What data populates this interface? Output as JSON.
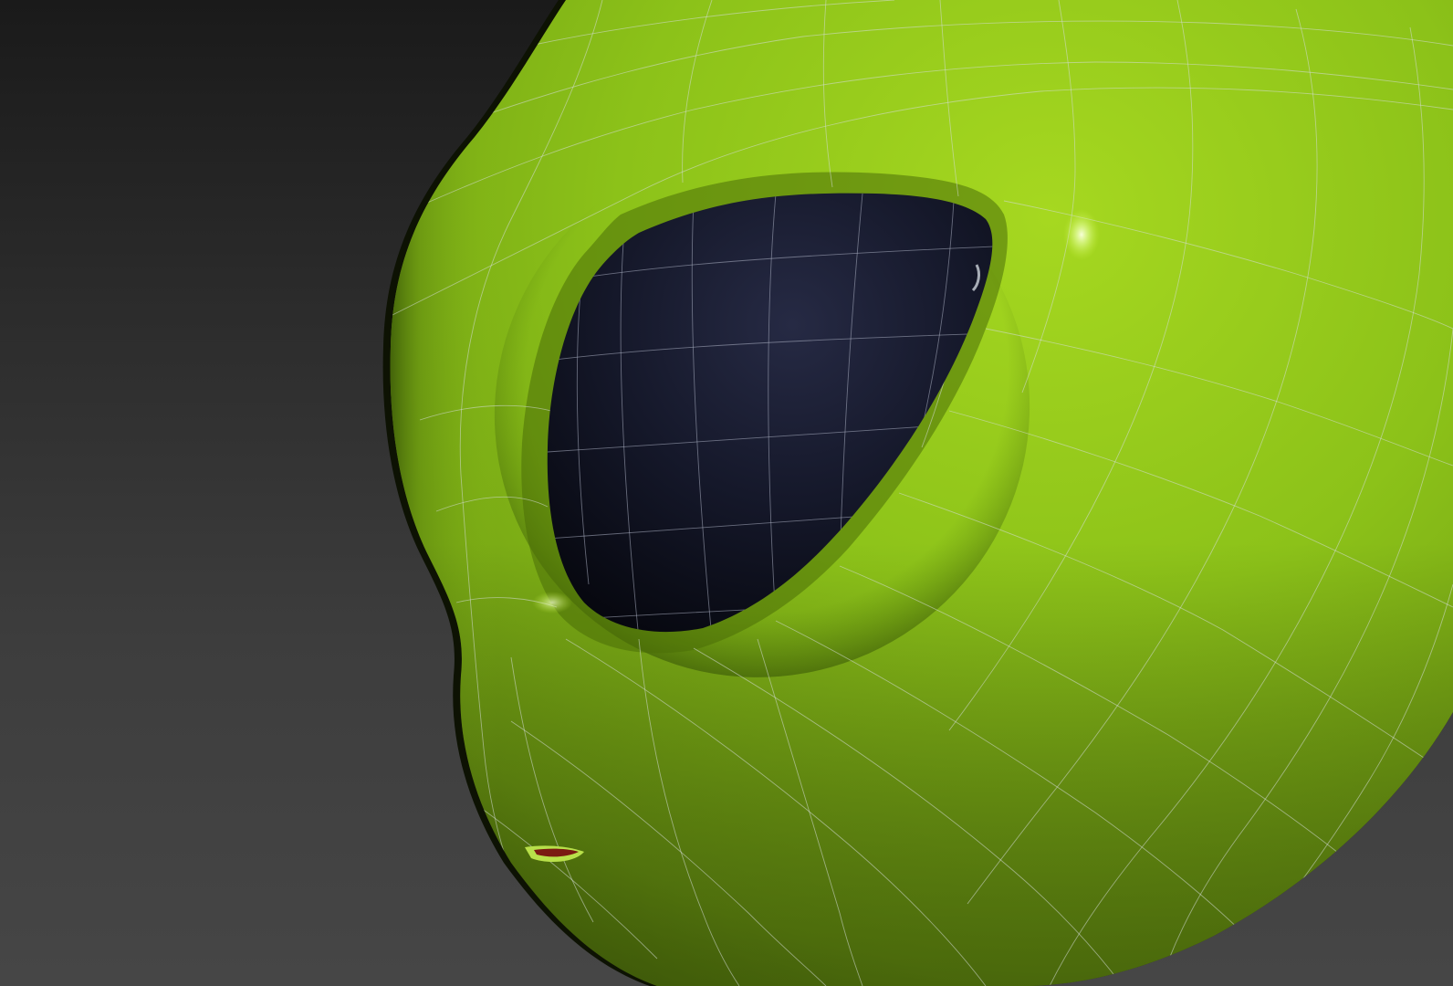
{
  "viewport": {
    "label": "",
    "background": {
      "top": "#1a1a1a",
      "bottom": "#464646"
    }
  },
  "model": {
    "subject": "alien-head",
    "shading": "smooth-with-wireframe",
    "colors": {
      "skin_light": "#a6d820",
      "skin_mid": "#8cc219",
      "skin_dark": "#5f8a0f",
      "eye_dark": "#0a0c16",
      "eye_mid": "#1c1f33",
      "wire": "#cfd6d8",
      "mouth": "#7a1a12"
    }
  }
}
